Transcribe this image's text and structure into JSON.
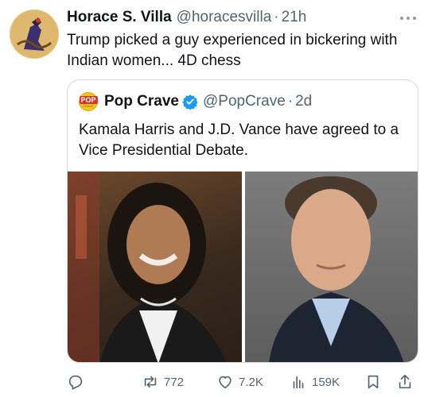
{
  "tweet": {
    "author_name": "Horace S. Villa",
    "author_handle": "@horacesvilla",
    "separator": "·",
    "time": "21h",
    "text": "Trump picked a guy experienced in bickering with Indian women... 4D chess",
    "more_icon": "ellipsis-icon"
  },
  "quote": {
    "logo_text": "POP",
    "logo_subtext": "CRAVE",
    "author_name": "Pop Crave",
    "author_handle": "@PopCrave",
    "separator": "·",
    "time": "2d",
    "text": "Kamala Harris and J.D. Vance have agreed to a Vice Presidential Debate.",
    "verified_color": "#1d9bf0"
  },
  "actions": {
    "reply_icon": "reply-icon",
    "retweet_count": "772",
    "like_count": "7.2K",
    "views_count": "159K",
    "bookmark_icon": "bookmark-icon",
    "share_icon": "share-icon"
  }
}
